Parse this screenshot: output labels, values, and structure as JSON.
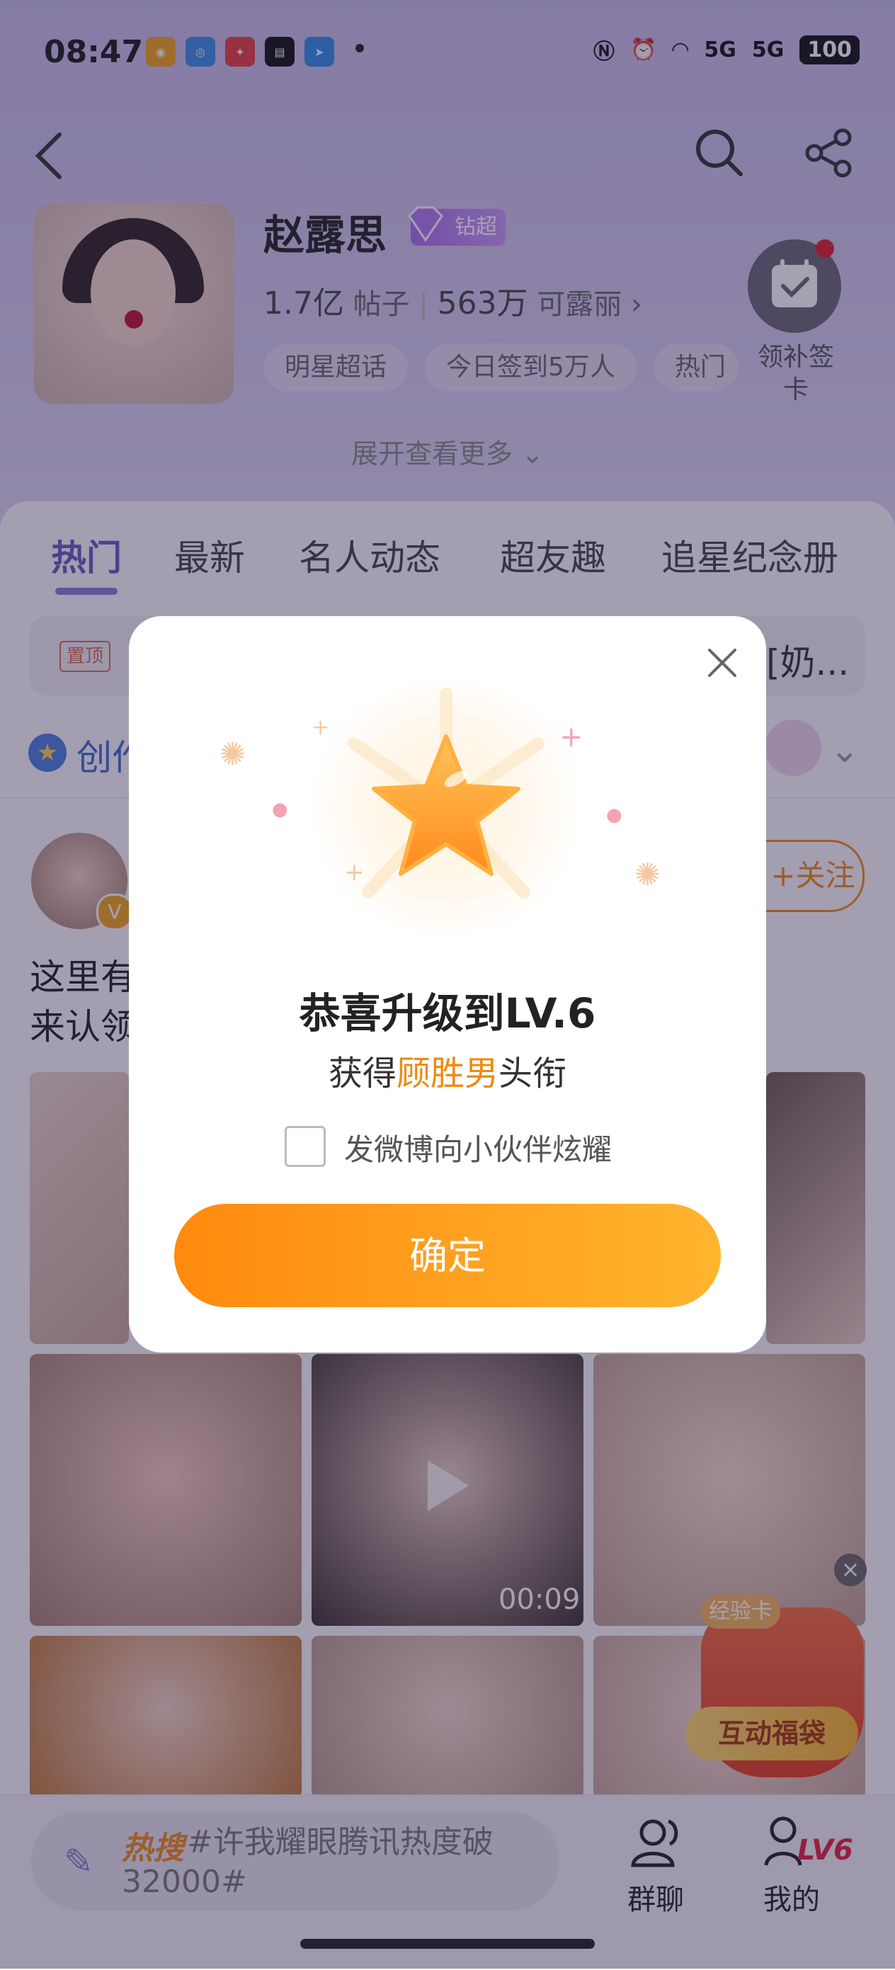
{
  "status_bar": {
    "time": "08:47",
    "signal1": "5G",
    "signal2": "5G",
    "battery": "100"
  },
  "header": {
    "title": "赵露思",
    "badge": "钻超",
    "posts_count": "1.7亿",
    "posts_label": "帖子",
    "fans_count": "563万",
    "fans_label": "可露丽 ›",
    "chips": [
      "明星超话",
      "今日签到5万人",
      "热门"
    ],
    "sign_label": "领补签卡",
    "expand": "展开查看更多 ⌄"
  },
  "tabs": [
    "热门",
    "最新",
    "名人动态",
    "超友趣",
    "追星纪念册"
  ],
  "pinned": {
    "tag": "置顶",
    "text_tail": "[奶..."
  },
  "creator": {
    "text": "创作"
  },
  "post": {
    "follow": "+关注",
    "text": "这里有 来认领",
    "duration": "00:09"
  },
  "floating": {
    "exp_card": "经验卡",
    "gift_bag": "互动福袋",
    "close": "×"
  },
  "bottom": {
    "hot_logo": "热搜",
    "hot_text": "#许我耀眼腾讯热度破32000#",
    "nav_group": "群聊",
    "nav_me": "我的",
    "level": "LV6"
  },
  "dialog": {
    "title": "恭喜升级到LV.6",
    "sub_prefix": "获得",
    "sub_highlight": "顾胜男",
    "sub_suffix": "头衔",
    "checkbox_label": "发微博向小伙伴炫耀",
    "confirm": "确定"
  },
  "colors": {
    "accent": "#6b58c3",
    "orange": "#f08a12",
    "tag_red": "#e06a4c"
  }
}
